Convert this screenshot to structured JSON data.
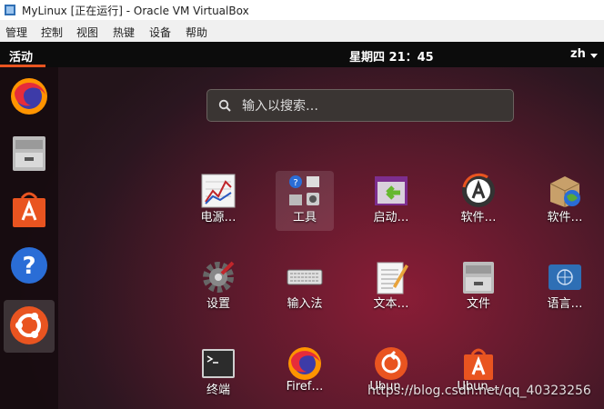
{
  "window": {
    "title": "MyLinux [正在运行] - Oracle VM VirtualBox"
  },
  "menubar": {
    "items": [
      "管理",
      "控制",
      "视图",
      "热键",
      "设备",
      "帮助"
    ]
  },
  "topbar": {
    "activities": "活动",
    "clock": "星期四 21：45",
    "language": "zh"
  },
  "dock": {
    "items": [
      "firefox-icon",
      "file-cabinet-icon",
      "software-store-icon",
      "help-icon",
      "app-grid-icon"
    ]
  },
  "search": {
    "placeholder": "输入以搜索…"
  },
  "apps": [
    {
      "label": "电源…",
      "icon": "power-statistics-icon"
    },
    {
      "label": "工具",
      "icon": "utilities-folder-icon"
    },
    {
      "label": "启动…",
      "icon": "startup-applications-icon"
    },
    {
      "label": "软件…",
      "icon": "software-updater-icon"
    },
    {
      "label": "软件…",
      "icon": "software-properties-icon"
    },
    {
      "label": "设置",
      "icon": "settings-gear-icon"
    },
    {
      "label": "输入法",
      "icon": "keyboard-icon"
    },
    {
      "label": "文本…",
      "icon": "text-editor-icon"
    },
    {
      "label": "文件",
      "icon": "file-cabinet-icon"
    },
    {
      "label": "语言…",
      "icon": "language-support-icon"
    },
    {
      "label": "终端",
      "icon": "terminal-icon"
    },
    {
      "label": "Firef…",
      "icon": "firefox-icon"
    },
    {
      "label": "Ubun…",
      "icon": "ubuntu-software-icon"
    },
    {
      "label": "Ubun…",
      "icon": "software-store-icon"
    }
  ],
  "watermark": "https://blog.csdn.net/qq_40323256"
}
